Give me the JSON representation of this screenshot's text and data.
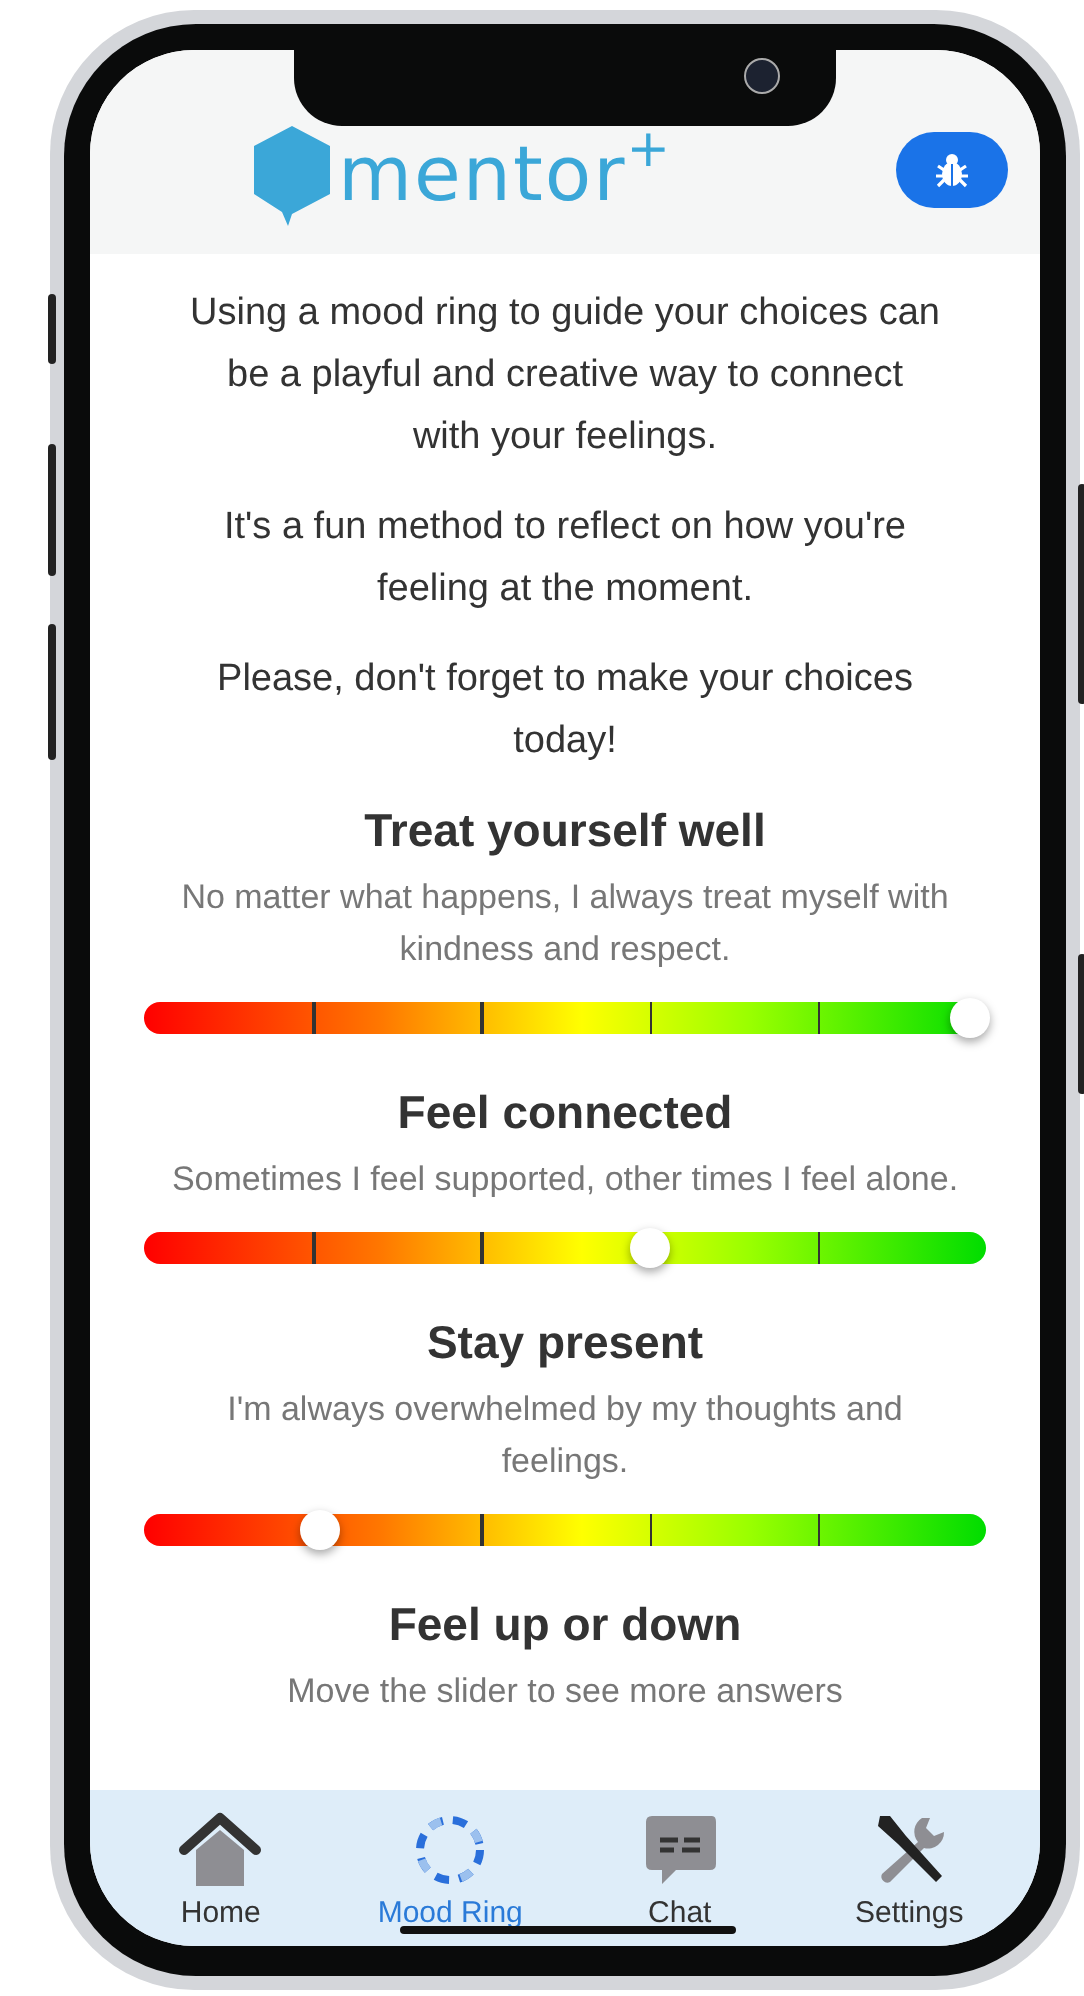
{
  "header": {
    "logo": "mentor$^{+}$"
  },
  "intro": [
    "Using a mood ring to guide your choices can be a playful and creative way to connect with your feelings.",
    "It's a fun method to reflect on how you're feeling at the moment.",
    "Please, don't forget to make your choices today!"
  ],
  "sliders": [
    {
      "title": "Treat yourself well",
      "description": "No matter what happens, I always treat myself with kindness and respect.",
      "level": 0.98
    },
    {
      "title": "Feel connected",
      "description": "Sometimes I feel supported, other times I feel alone.",
      "level": 0.6
    },
    {
      "title": "Stay present",
      "description": "I'm always overwhelmed by my thoughts and feelings.",
      "level": 0.21
    },
    {
      "title": "Feel up or down",
      "description": "Move the slider to see more answers"
    }
  ],
  "tabs": [
    {
      "kind": "home",
      "label": "Home",
      "selected": false
    },
    {
      "kind": "ring",
      "label": "Mood Ring",
      "selected": true
    },
    {
      "kind": "chat",
      "label": "Chat",
      "selected": false
    },
    {
      "kind": "settings",
      "label": "Settings",
      "selected": false
    }
  ]
}
